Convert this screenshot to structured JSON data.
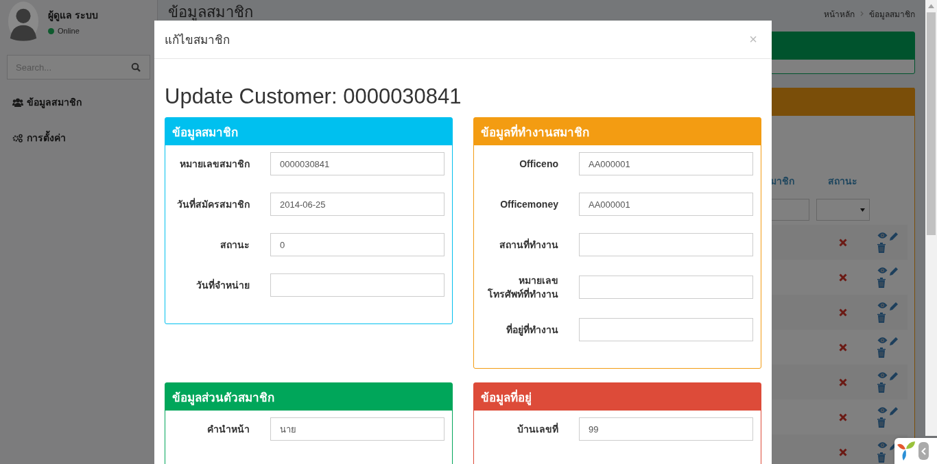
{
  "sidebar": {
    "user": {
      "name": "ผู้ดูแล ระบบ",
      "status": "Online"
    },
    "search": {
      "placeholder": "Search..."
    },
    "menu": [
      {
        "label": "ข้อมูลสมาชิก"
      },
      {
        "label": "การตั้งค่า"
      }
    ]
  },
  "page": {
    "title": "ข้อมูลสมาชิก",
    "breadcrumb": [
      "หน้าหลัก",
      "ข้อมูลสมาชิก"
    ],
    "table": {
      "columns": [
        "มาชิก",
        "สถานะ"
      ],
      "rows": [
        {
          "active": false
        },
        {
          "active": false
        },
        {
          "active": false
        },
        {
          "active": false
        },
        {
          "active": false
        },
        {
          "active": false
        },
        {
          "active": false
        }
      ]
    }
  },
  "modal": {
    "title": "แก้ไขสมาชิก",
    "close": "×",
    "heading": "Update Customer: 0000030841",
    "panels": [
      {
        "title": "ข้อมูลสมาชิก",
        "color": "#00c0ef",
        "fields": [
          {
            "label": "หมายเลขสมาชิก",
            "value": "0000030841"
          },
          {
            "label": "วันที่สมัครสมาชิก",
            "value": "2014-06-25"
          },
          {
            "label": "สถานะ",
            "value": "0"
          },
          {
            "label": "วันที่จำหน่าย"
          }
        ]
      },
      {
        "title": "ข้อมูลที่ทำงานสมาชิก",
        "color": "#f39c12",
        "fields": [
          {
            "label": "Officeno",
            "value": "AA000001"
          },
          {
            "label": "Officemoney",
            "value": "AA000001"
          },
          {
            "label": "สถานที่ทำงาน"
          },
          {
            "label": "หมายเลข\nโทรศัพท์ที่ทำงาน"
          },
          {
            "label": "ที่อยู่ที่ทำงาน"
          }
        ]
      },
      {
        "title": "ข้อมูลส่วนตัวสมาชิก",
        "color": "#00a65a",
        "fields": [
          {
            "label": "คำนำหน้า",
            "value": "นาย"
          }
        ]
      },
      {
        "title": "ข้อมูลที่อยู่",
        "color": "#dd4b39",
        "fields": [
          {
            "label": "บ้านเลขที่",
            "value": "99"
          }
        ]
      }
    ]
  }
}
